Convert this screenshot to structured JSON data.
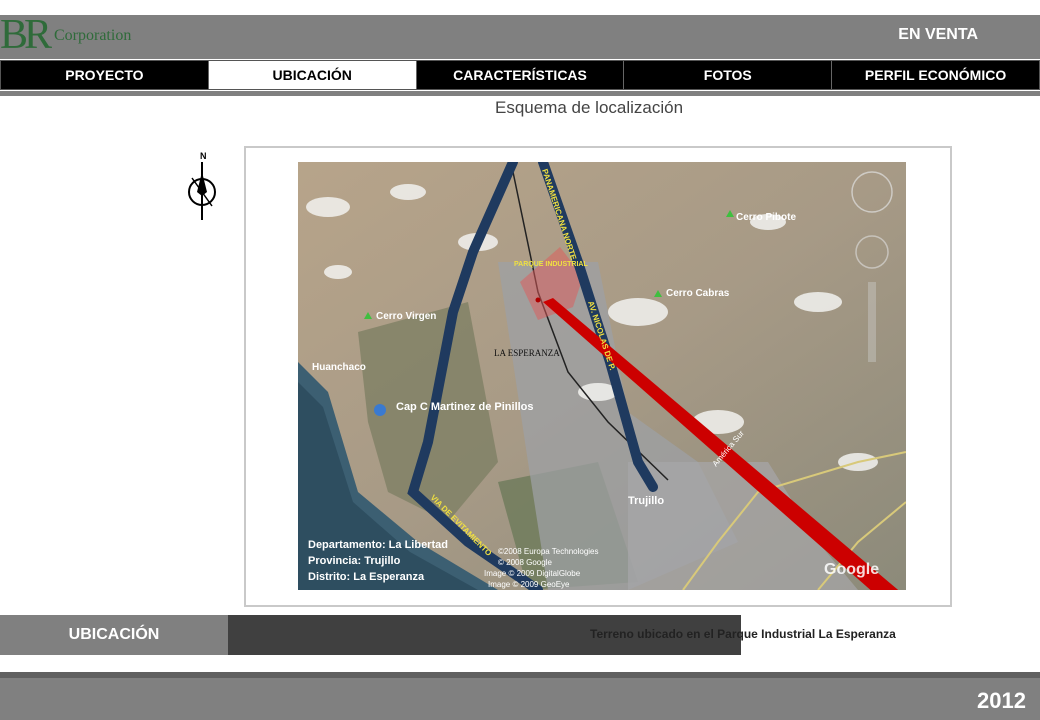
{
  "logo": {
    "mark": "BR",
    "text": "Corporation"
  },
  "header": {
    "status": "EN VENTA"
  },
  "tabs": [
    {
      "label": "PROYECTO"
    },
    {
      "label": "UBICACIÓN"
    },
    {
      "label": "CARACTERÍSTICAS"
    },
    {
      "label": "FOTOS"
    },
    {
      "label": "PERFIL ECONÓMICO"
    }
  ],
  "page": {
    "subtitle": "Esquema de localización"
  },
  "compass": {
    "letter": "N"
  },
  "map": {
    "labels": {
      "panamericana": "PANAMERICANA NORTE",
      "av_nicolas": "AV. NICOLAS DE P.",
      "via_evitamiento": "VIA DE EVITAMIENTO",
      "parque": "PARQUE INDUSTRIAL",
      "la_esperanza": "LA ESPERANZA",
      "cerro_pibote": "Cerro Pibote",
      "cerro_cabras": "Cerro Cabras",
      "cerro_virgen": "Cerro Virgen",
      "huanchaco": "Huanchaco",
      "cap_martinez": "Cap C Martinez de Pinillos",
      "trujillo": "Trujillo",
      "america_sur": "América Sur",
      "google": "Google",
      "copyright_1": "©2008 Europa Technologies",
      "copyright_2": "© 2008 Google",
      "copyright_3": "Image © 2009 DigitalGlobe",
      "copyright_4": "Image © 2009 GeoEye"
    },
    "info": {
      "departamento": "Departamento: La Libertad",
      "provincia": "Provincia: Trujillo",
      "distrito": "Distrito: La Esperanza"
    }
  },
  "footer_section": {
    "label": "UBICACIÓN",
    "note": "Terreno ubicado en el Parque Industrial La Esperanza"
  },
  "footer": {
    "year": "2012"
  },
  "colors": {
    "bar": "#808080",
    "tab_bg": "#000000",
    "road": "#1f3a5f",
    "pointer": "#cc0000",
    "logo": "#2f6b3a"
  }
}
